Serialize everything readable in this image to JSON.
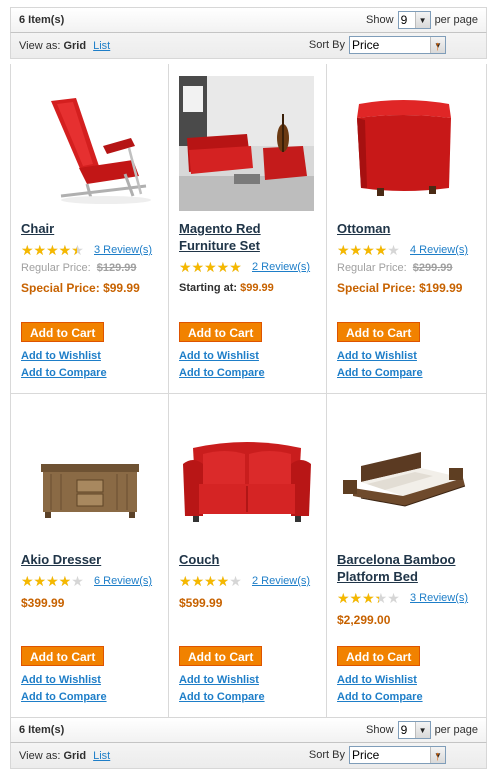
{
  "toolbar_top": {
    "amount": "6 Item(s)",
    "show_label": "Show",
    "limit_value": "9",
    "per_page_label": "per page",
    "view_as_label": "View as:",
    "grid_label": "Grid",
    "list_label": "List",
    "sort_by_label": "Sort By",
    "sort_value": "Price",
    "sort_direction_icon": "arrow-up"
  },
  "toolbar_bottom": {
    "amount": "6 Item(s)",
    "show_label": "Show",
    "limit_value": "9",
    "per_page_label": "per page",
    "view_as_label": "View as:",
    "grid_label": "Grid",
    "list_label": "List",
    "sort_by_label": "Sort By",
    "sort_value": "Price",
    "sort_direction_icon": "arrow-up"
  },
  "colors": {
    "accent_button": "#f18200",
    "price": "#c76200",
    "link": "#1e7ec8",
    "star": "#f5b800"
  },
  "products": [
    {
      "name": "Chair",
      "rating_fraction": 0.8,
      "reviews": "3 Review(s)",
      "regular_label": "Regular Price:",
      "regular_price": "$129.99",
      "special_label": "Special Price:",
      "special_price": "$99.99",
      "add_to_cart": "Add to Cart",
      "add_to_wishlist": "Add to Wishlist",
      "add_to_compare": "Add to Compare",
      "image_icon": "red-lounge-chair"
    },
    {
      "name": "Magento Red Furniture Set",
      "rating_fraction": 0.9,
      "reviews": "2 Review(s)",
      "starting_label": "Starting at:",
      "starting_price": "$99.99",
      "add_to_cart": "Add to Cart",
      "add_to_wishlist": "Add to Wishlist",
      "add_to_compare": "Add to Compare",
      "image_icon": "red-furniture-set"
    },
    {
      "name": "Ottoman",
      "rating_fraction": 0.7,
      "reviews": "4 Review(s)",
      "regular_label": "Regular Price:",
      "regular_price": "$299.99",
      "special_label": "Special Price:",
      "special_price": "$199.99",
      "add_to_cart": "Add to Cart",
      "add_to_wishlist": "Add to Wishlist",
      "add_to_compare": "Add to Compare",
      "image_icon": "red-ottoman"
    },
    {
      "name": "Akio Dresser",
      "rating_fraction": 0.7,
      "reviews": "6 Review(s)",
      "price": "$399.99",
      "add_to_cart": "Add to Cart",
      "add_to_wishlist": "Add to Wishlist",
      "add_to_compare": "Add to Compare",
      "image_icon": "wooden-dresser"
    },
    {
      "name": "Couch",
      "rating_fraction": 0.7,
      "reviews": "2 Review(s)",
      "price": "$599.99",
      "add_to_cart": "Add to Cart",
      "add_to_wishlist": "Add to Wishlist",
      "add_to_compare": "Add to Compare",
      "image_icon": "red-couch"
    },
    {
      "name": "Barcelona Bamboo Platform Bed",
      "rating_fraction": 0.6,
      "reviews": "3 Review(s)",
      "price": "$2,299.00",
      "add_to_cart": "Add to Cart",
      "add_to_wishlist": "Add to Wishlist",
      "add_to_compare": "Add to Compare",
      "image_icon": "platform-bed"
    }
  ]
}
